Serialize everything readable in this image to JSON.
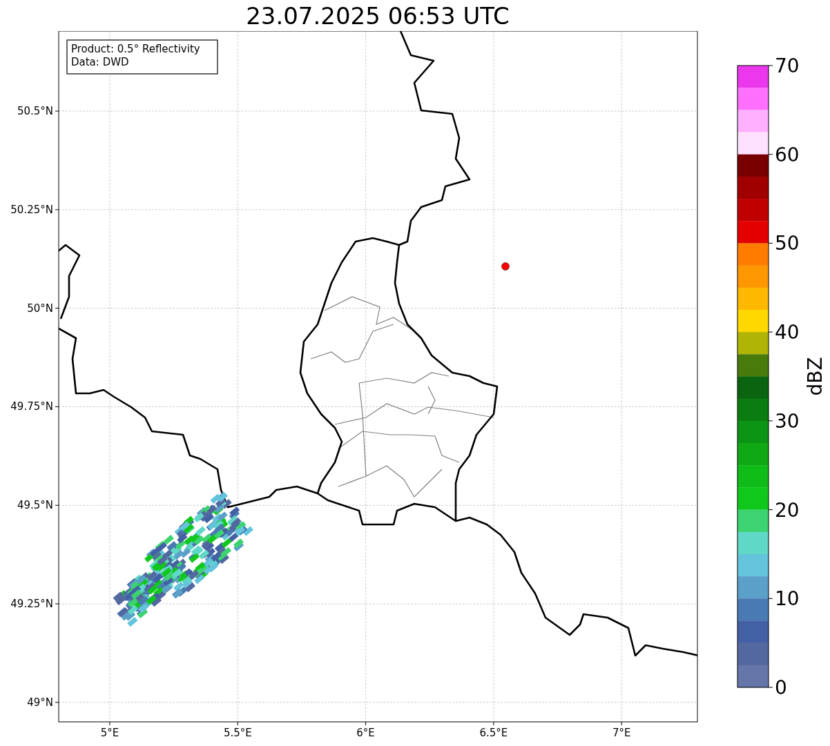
{
  "title": "23.07.2025 06:53 UTC",
  "map": {
    "info_box": [
      "Product: 0.5° Reflectivity",
      "Data: DWD"
    ],
    "lat_labels": [
      "50.5°N",
      "50.25°N",
      "50°N",
      "49.75°N",
      "49.5°N",
      "49.25°N",
      "49°N"
    ],
    "lon_labels": [
      "5°E",
      "5.5°E",
      "6°E",
      "6.5°E",
      "7°E"
    ]
  },
  "colorbar": {
    "label": "dBZ",
    "ticks": [
      "70",
      "60",
      "50",
      "40",
      "30",
      "20",
      "10",
      "0"
    ],
    "bands": [
      {
        "color": "#ec38ec"
      },
      {
        "color": "#ff70ff"
      },
      {
        "color": "#ffb0ff"
      },
      {
        "color": "#ffe0ff"
      },
      {
        "color": "#780000"
      },
      {
        "color": "#a00000"
      },
      {
        "color": "#c00000"
      },
      {
        "color": "#e40000"
      },
      {
        "color": "#ff7c00"
      },
      {
        "color": "#ff9800"
      },
      {
        "color": "#ffb800"
      },
      {
        "color": "#ffd800"
      },
      {
        "color": "#b0b404"
      },
      {
        "color": "#487a0c"
      },
      {
        "color": "#0a6410"
      },
      {
        "color": "#0a7c10"
      },
      {
        "color": "#0c9414"
      },
      {
        "color": "#10a814"
      },
      {
        "color": "#10bc18"
      },
      {
        "color": "#10c81c"
      },
      {
        "color": "#3cd470"
      },
      {
        "color": "#60d8c8"
      },
      {
        "color": "#64c4dc"
      },
      {
        "color": "#5aa0c8"
      },
      {
        "color": "#4a7ab4"
      },
      {
        "color": "#4460a4"
      },
      {
        "color": "#5468a0"
      },
      {
        "color": "#6676a8"
      }
    ]
  }
}
